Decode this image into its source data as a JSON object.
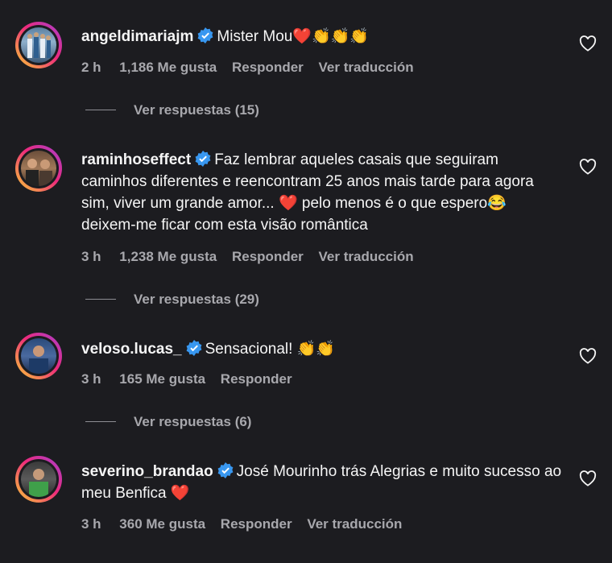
{
  "comments": [
    {
      "username": "angeldimariajm",
      "text": "Mister Mou❤️👏👏👏",
      "time": "2 h",
      "likes": "1,186 Me gusta",
      "reply": "Responder",
      "translate": "Ver traducción",
      "view_replies": "Ver respuestas (15)"
    },
    {
      "username": "raminhoseffect",
      "text": "Faz lembrar aqueles casais que seguiram caminhos diferentes e reencontram 25 anos mais tarde para agora sim, viver um grande amor... ❤️ pelo menos é o que espero😂 deixem-me ficar com esta visão romântica",
      "time": "3 h",
      "likes": "1,238 Me gusta",
      "reply": "Responder",
      "translate": "Ver traducción",
      "view_replies": "Ver respuestas (29)"
    },
    {
      "username": "veloso.lucas_",
      "text": "Sensacional! 👏👏",
      "time": "3 h",
      "likes": "165 Me gusta",
      "reply": "Responder",
      "view_replies": "Ver respuestas (6)"
    },
    {
      "username": "severino_brandao",
      "text": "José Mourinho trás Alegrias e muito sucesso ao meu Benfica ❤️",
      "time": "3 h",
      "likes": "360 Me gusta",
      "reply": "Responder",
      "translate": "Ver traducción"
    }
  ],
  "colors": {
    "background": "#1c1c20",
    "verified": "#3897f0",
    "muted": "#a8a8ad"
  },
  "icons": {
    "verified": "verified-badge-icon",
    "like": "heart-outline-icon"
  }
}
